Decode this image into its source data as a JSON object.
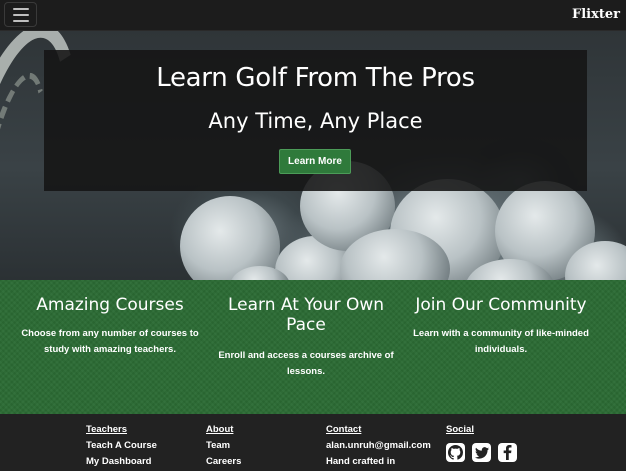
{
  "navbar": {
    "menu_icon": "hamburger-icon",
    "brand": "Flixter"
  },
  "hero": {
    "title": "Learn Golf From The Pros",
    "subtitle": "Any Time, Any Place",
    "button_label": "Learn More"
  },
  "features": [
    {
      "title": "Amazing Courses",
      "text": "Choose from any number of courses to study with amazing teachers."
    },
    {
      "title": "Learn At Your Own Pace",
      "text": "Enroll and access a courses archive of lessons."
    },
    {
      "title": "Join Our Community",
      "text": "Learn with a community of like-minded individuals."
    }
  ],
  "footer": {
    "teachers": {
      "heading": "Teachers",
      "links": [
        "Teach A Course",
        "My Dashboard"
      ]
    },
    "about": {
      "heading": "About",
      "links": [
        "Team",
        "Careers"
      ]
    },
    "contact": {
      "heading": "Contact",
      "email": "alan.unruh@gmail.com",
      "crafted": "Hand crafted in"
    },
    "social": {
      "heading": "Social",
      "icons": [
        "github-icon",
        "twitter-icon",
        "facebook-icon"
      ]
    }
  },
  "colors": {
    "navbar_bg": "#1c1c1c",
    "accent_green": "#2b6b34",
    "button_green": "#2f7a3b",
    "footer_bg": "#222222"
  }
}
